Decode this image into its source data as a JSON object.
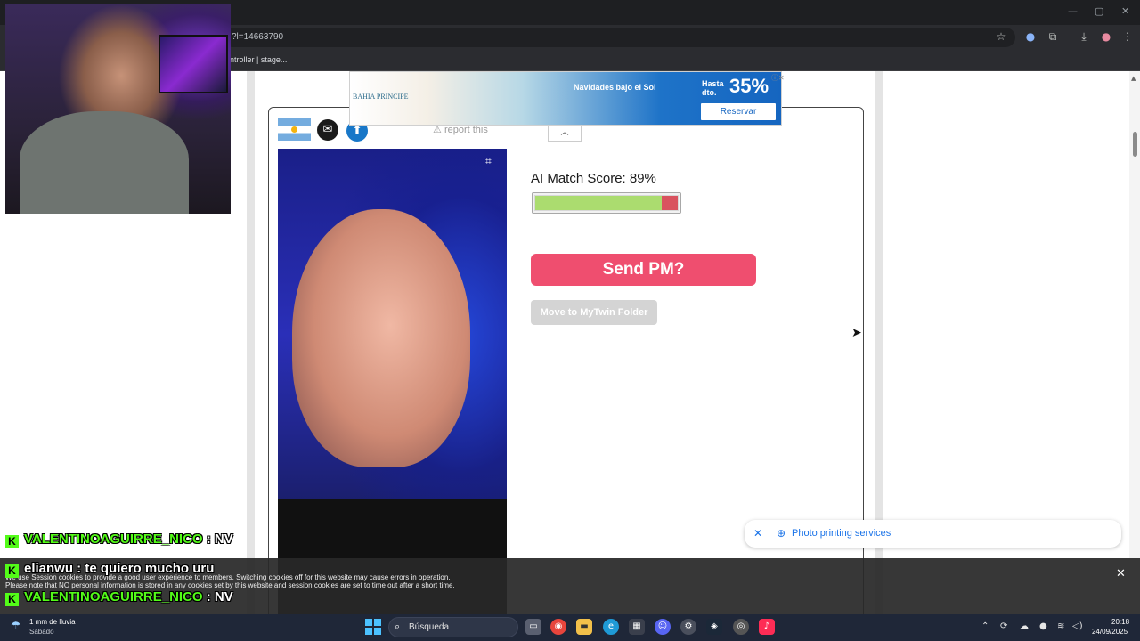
{
  "browser": {
    "url": "?l=14663790",
    "bookmark": "ntroller | stage..."
  },
  "card": {
    "report_label": "report this",
    "match_label": "AI Match Score: 89%",
    "match_score": 0.89,
    "send_pm_label": "Send PM?",
    "mytwin_label": "Move to MyTwin Folder"
  },
  "ad": {
    "brand": "BAHIA PRINCIPE",
    "headline": "Navidades bajo el Sol",
    "discount_label": "Hasta dto.",
    "discount": "35%",
    "cta": "Reservar"
  },
  "suggestion": {
    "text": "Photo printing services"
  },
  "cookie": {
    "line1": "We use Session cookies to provide a good user experience to members. Switching cookies off for this website may cause errors in operation.",
    "line2": "Please note that NO personal information is stored in any cookies set by this website and session cookies are set to time out after a short time."
  },
  "chat": [
    {
      "user": "VALENTINOAGUIRRE_NICO",
      "sep": " : ",
      "msg": "NV"
    },
    {
      "user": "elianwu",
      "sep": " : ",
      "msg": "te quiero mucho uru"
    },
    {
      "user": "VALENTINOAGUIRRE_NICO",
      "sep": " : ",
      "msg": "NV"
    }
  ],
  "taskbar": {
    "weather_line1": "1 mm de lluvia",
    "weather_line2": "Sábado",
    "search_placeholder": "Búsqueda",
    "time": "20:18",
    "date": "24/09/2025"
  },
  "colors": {
    "send_pm": "#ef4e6f",
    "match_fill": "#abdc6f",
    "match_rest": "#d9535f",
    "kick_green": "#53fc18",
    "taskbar": "#1f2738"
  },
  "icons": [
    "envelope-icon",
    "share-icon",
    "warning-icon",
    "camera-icon",
    "chevron-up-icon",
    "close-icon",
    "star-icon",
    "download-icon",
    "windows-icon",
    "search-icon"
  ]
}
